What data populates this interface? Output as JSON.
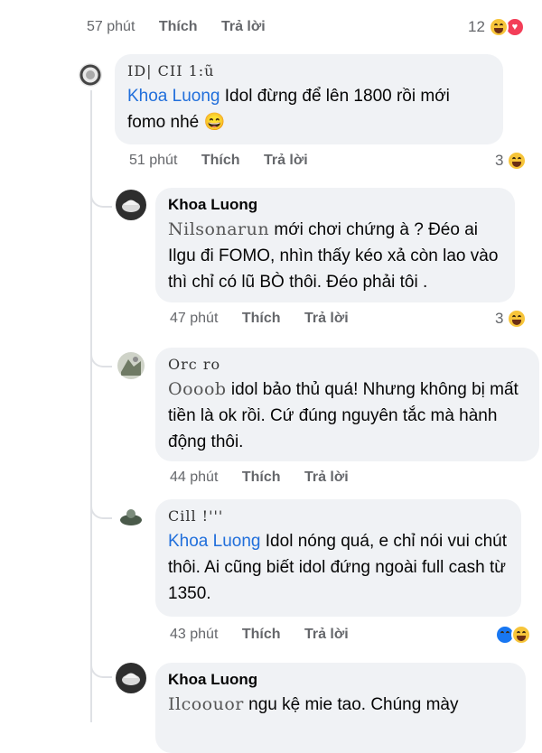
{
  "actions": {
    "like": "Thích",
    "reply": "Trả lời"
  },
  "top_comment": {
    "time": "57 phút",
    "reaction_count": "12"
  },
  "comments": [
    {
      "author": "ID| CII 1:ũ",
      "mention": "Khoa Luong",
      "text": " Idol đừng để lên 1800 rồi mới fomo nhé 😄",
      "time": "51 phút",
      "reaction_count": "3"
    },
    {
      "author": "Khoa Luong",
      "obscured": "Nilsonarun",
      "text": " mới chơi chứng à ? Đéo ai Ilgu đi FOMO, nhìn thấy kéo xả còn lao vào thì chỉ có lũ BÒ thôi. Đéo phải tôi .",
      "time": "47 phút",
      "reaction_count": "3"
    },
    {
      "author": "Orc           ro",
      "obscured": "Oooob",
      "text": " idol bảo thủ quá! Nhưng không bị mất tiền là ok rồi. Cứ đúng nguyên tắc mà hành động thôi.",
      "time": "44 phút",
      "reaction_count": ""
    },
    {
      "author": "Cill  !'''",
      "mention": "Khoa Luong",
      "text": " Idol nóng quá, e chỉ nói vui chút thôi. Ai cũng biết idol đứng ngoài full cash từ 1350.",
      "time": "43 phút",
      "reaction_count": ""
    },
    {
      "author": "Khoa Luong",
      "obscured": "Ilcoouor",
      "text": " ngu kệ mie tao. Chúng mày",
      "time": "",
      "reaction_count": ""
    }
  ]
}
